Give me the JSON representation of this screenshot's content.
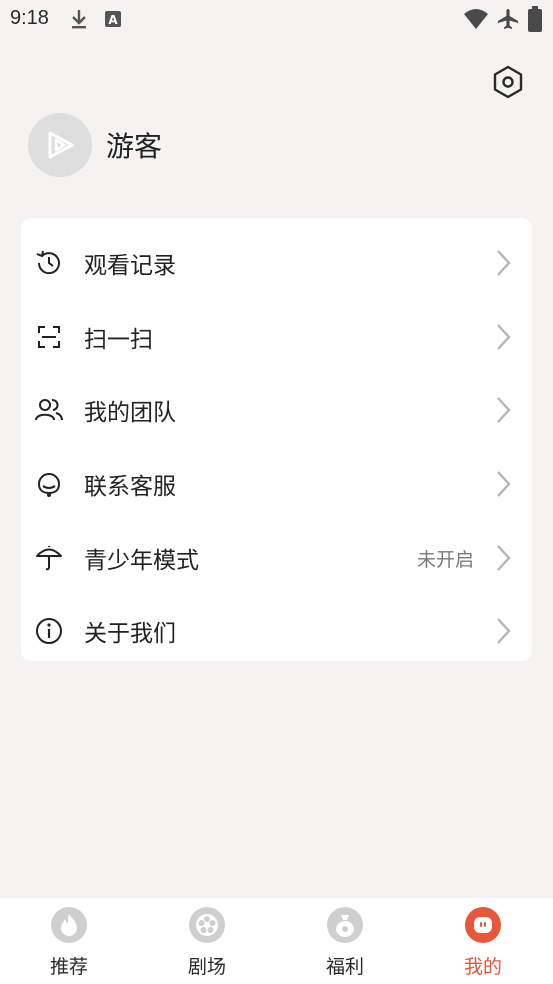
{
  "status_bar": {
    "time": "9:18",
    "icons": [
      "download-icon",
      "keyboard-a-icon",
      "wifi-icon",
      "airplane-icon",
      "battery-icon"
    ]
  },
  "header": {
    "settings_icon": "settings-hexagon-icon"
  },
  "profile": {
    "name": "游客",
    "avatar_icon": "play-logo-icon"
  },
  "menu": {
    "items": [
      {
        "label": "观看记录",
        "icon": "history-clock-icon",
        "value": ""
      },
      {
        "label": "扫一扫",
        "icon": "scan-icon",
        "value": ""
      },
      {
        "label": "我的团队",
        "icon": "team-icon",
        "value": ""
      },
      {
        "label": "联系客服",
        "icon": "headset-icon",
        "value": ""
      },
      {
        "label": "青少年模式",
        "icon": "umbrella-icon",
        "value": "未开启"
      },
      {
        "label": "关于我们",
        "icon": "info-icon",
        "value": ""
      }
    ]
  },
  "tab_bar": {
    "tabs": [
      {
        "label": "推荐",
        "icon": "flame-icon",
        "active": false
      },
      {
        "label": "剧场",
        "icon": "film-reel-icon",
        "active": false
      },
      {
        "label": "福利",
        "icon": "money-bag-icon",
        "active": false
      },
      {
        "label": "我的",
        "icon": "profile-face-icon",
        "active": true
      }
    ],
    "active_color": "#e8563b",
    "inactive_icon_color": "#cfcfcf"
  }
}
